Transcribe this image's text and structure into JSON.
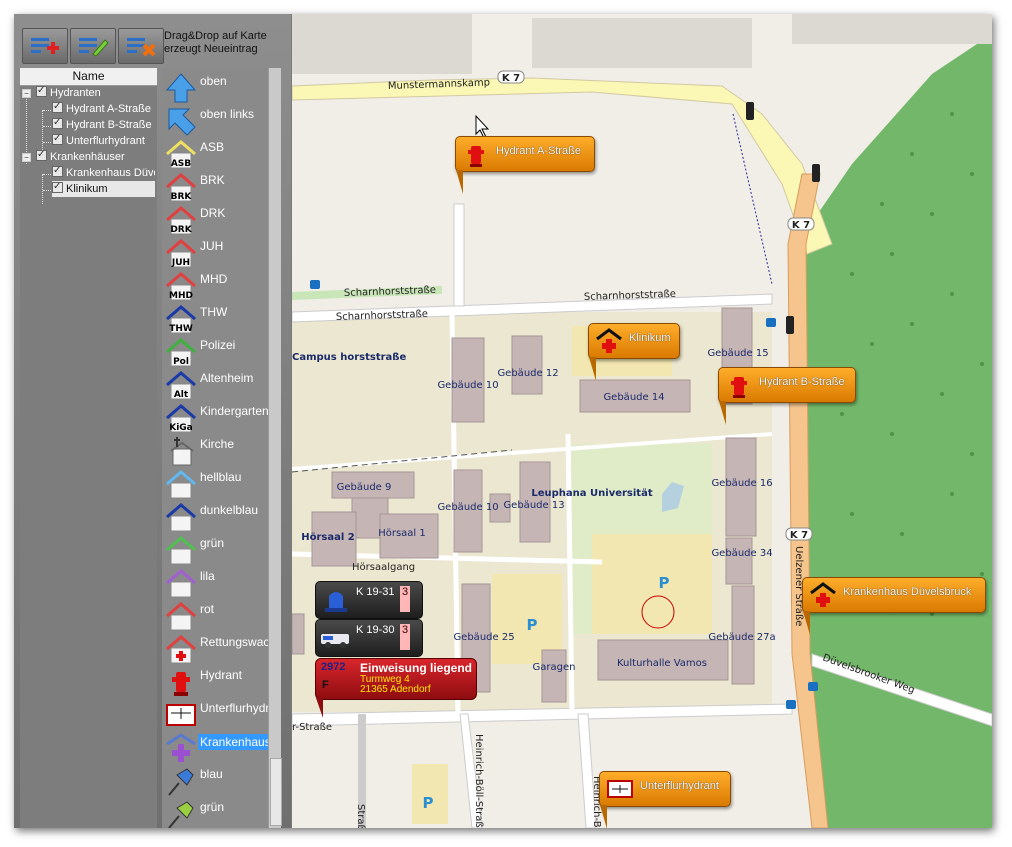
{
  "hint": {
    "line1": "Drag&Drop auf Karte",
    "line2": "erzeugt Neueintrag"
  },
  "toolbar": {
    "add_icon": "list-add-icon",
    "edit_icon": "list-edit-icon",
    "delete_icon": "list-delete-icon"
  },
  "tree": {
    "header": "Name",
    "items": [
      {
        "label": "Hydranten",
        "level": 0
      },
      {
        "label": "Hydrant A-Straße",
        "level": 1
      },
      {
        "label": "Hydrant B-Straße",
        "level": 1
      },
      {
        "label": "Unterflurhydrant",
        "level": 1
      },
      {
        "label": "Krankenhäuser",
        "level": 0
      },
      {
        "label": "Krankenhaus Düvelsbruck",
        "level": 1
      },
      {
        "label": "Klinikum",
        "level": 1
      }
    ]
  },
  "palette": [
    {
      "label": "oben",
      "icon": "arrow-up-icon"
    },
    {
      "label": "oben links",
      "icon": "arrow-up-left-icon"
    },
    {
      "label": "ASB",
      "icon": "house-asb-icon",
      "abbr": "ASB",
      "color": "#f0e060"
    },
    {
      "label": "BRK",
      "icon": "house-brk-icon",
      "abbr": "BRK",
      "color": "#e04040"
    },
    {
      "label": "DRK",
      "icon": "house-drk-icon",
      "abbr": "DRK",
      "color": "#e04040"
    },
    {
      "label": "JUH",
      "icon": "house-juh-icon",
      "abbr": "JUH",
      "color": "#e04040"
    },
    {
      "label": "MHD",
      "icon": "house-mhd-icon",
      "abbr": "MHD",
      "color": "#e04040"
    },
    {
      "label": "THW",
      "icon": "house-thw-icon",
      "abbr": "THW",
      "color": "#1a3aa8"
    },
    {
      "label": "Polizei",
      "icon": "house-police-icon",
      "abbr": "Pol",
      "color": "#40b040"
    },
    {
      "label": "Altenheim",
      "icon": "house-altenheim-icon",
      "abbr": "Alt",
      "color": "#1a3aa8"
    },
    {
      "label": "Kindergarten",
      "icon": "house-kindergarten-icon",
      "abbr": "KiGa",
      "color": "#1a3aa8"
    },
    {
      "label": "Kirche",
      "icon": "church-icon"
    },
    {
      "label": "hellblau",
      "icon": "house-lightblue-icon",
      "color": "#60b8f0"
    },
    {
      "label": "dunkelblau",
      "icon": "house-darkblue-icon",
      "color": "#1a3aa8"
    },
    {
      "label": "grün",
      "icon": "house-green-icon",
      "color": "#50c050"
    },
    {
      "label": "lila",
      "icon": "house-purple-icon",
      "color": "#a060d0"
    },
    {
      "label": "rot",
      "icon": "house-red-icon",
      "color": "#e04040"
    },
    {
      "label": "Rettungswache",
      "icon": "house-rescue-icon",
      "color": "#e04040"
    },
    {
      "label": "Hydrant",
      "icon": "hydrant-icon"
    },
    {
      "label": "Unterflurhydrant",
      "icon": "underground-hydrant-icon"
    },
    {
      "label": "Krankenhaus",
      "icon": "hospital-icon",
      "selected": true
    },
    {
      "label": "blau",
      "icon": "pin-blue-icon",
      "color": "#3a7ad8"
    },
    {
      "label": "grün",
      "icon": "pin-green-icon",
      "color": "#9ad040"
    }
  ],
  "map": {
    "streets": {
      "munstermannskamp": "Munstermannskamp",
      "k7": "K 7",
      "scharnhorst1": "Scharnhorststraße",
      "scharnhorst2": "Scharnhorststraße",
      "scharnhorst3": "Scharnhorststraße",
      "uelzener": "Uelzener Straße",
      "duevelsbrooker": "Düvelsbrooker Weg",
      "hoersaalgang": "Hörsaalgang",
      "heinrich_boell": "Heinrich-Böll-Straße",
      "heinrich_b": "Heinrich-B",
      "strasse_left": "r-Straße",
      "strasse_bottom": "Straße"
    },
    "buildings": [
      "Gebäude 10",
      "Gebäude 12",
      "Gebäude 14",
      "Gebäude 15",
      "Gebäude 9",
      "Gebäude 10",
      "Gebäude 13",
      "Gebäude 16",
      "Gebäude 34",
      "Gebäude 25",
      "Gebäude 27a",
      "Hörsaal 2",
      "Hörsaal 1",
      "Garagen",
      "Kulturhalle Vamos",
      "Leuphana Universität",
      "Campus horststraße"
    ],
    "parking": "P"
  },
  "callouts": [
    {
      "label": "Hydrant A-Straße",
      "icon": "hydrant-icon"
    },
    {
      "label": "Klinikum",
      "icon": "hospital-icon"
    },
    {
      "label": "Hydrant B-Straße",
      "icon": "hydrant-icon"
    },
    {
      "label": "Krankenhaus Düvelsbruck",
      "icon": "hospital-icon"
    },
    {
      "label": "Unterflurhydrant",
      "icon": "underground-hydrant-icon"
    }
  ],
  "units": [
    {
      "label": "K 19-31",
      "count": "3",
      "icon": "blue-light-icon"
    },
    {
      "label": "K 19-30",
      "count": "3",
      "icon": "vehicle-icon"
    }
  ],
  "alarm": {
    "number": "2972",
    "title": "Einweisung liegend",
    "flag": "F",
    "street": "Turmweg 4",
    "city": "21365 Adendorf"
  }
}
